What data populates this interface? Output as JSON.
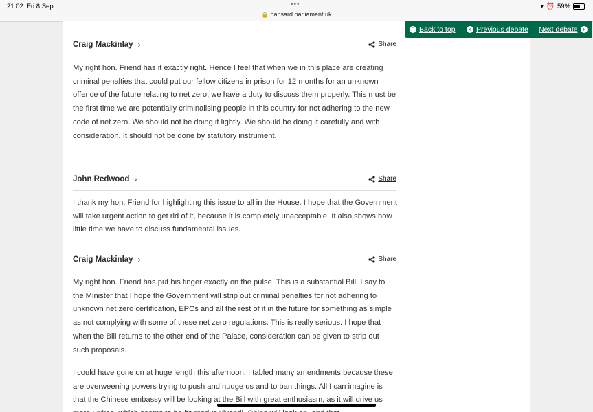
{
  "status_bar": {
    "time": "21:02",
    "date": "Fri 8 Sep",
    "dots": "•••",
    "url": "hansard.parliament.uk",
    "battery": "59%"
  },
  "nav": {
    "back_to_top": "Back to top",
    "previous_debate": "Previous debate",
    "next_debate": "Next debate",
    "accent_color": "#00694a"
  },
  "contributions": [
    {
      "speaker": "Craig Mackinlay",
      "share": "Share",
      "paragraphs": [
        "My right hon. Friend has it exactly right. Hence I feel that when we in this place are creating criminal penalties that could put our fellow citizens in prison for 12 months for an unknown offence of the future relating to net zero, we have a duty to discuss them properly. This must be the first time we are potentially criminalising people in this country for not adhering to the new code of net zero. We should not be doing it lightly. We should be doing it carefully and with consideration. It should not be done by statutory instrument."
      ]
    },
    {
      "speaker": "John Redwood",
      "share": "Share",
      "paragraphs": [
        "I thank my hon. Friend for highlighting this issue to all in the House. I hope that the Government will take urgent action to get rid of it, because it is completely unacceptable. It also shows how little time we have to discuss fundamental issues."
      ]
    },
    {
      "speaker": "Craig Mackinlay",
      "share": "Share",
      "paragraphs": [
        "My right hon. Friend has put his finger exactly on the pulse. This is a substantial Bill. I say to the Minister that I hope the Government will strip out criminal penalties for not adhering to unknown net zero certification, EPCs and all the rest of it in the future for something as simple as not complying with some of these net zero regulations. This is really serious. I hope that when the Bill returns to the other end of the Palace, consideration can be given to strip out such proposals.",
        "I could have gone on at huge length this afternoon. I tabled many amendments because these are overweening powers trying to push and nudge us and to ban things. All I can imagine is that the Chinese embassy will be looking at the Bill with great enthusiasm, as it will drive us more unfree, which seems to be its modus vivendi. China will look on, and that"
      ]
    }
  ]
}
